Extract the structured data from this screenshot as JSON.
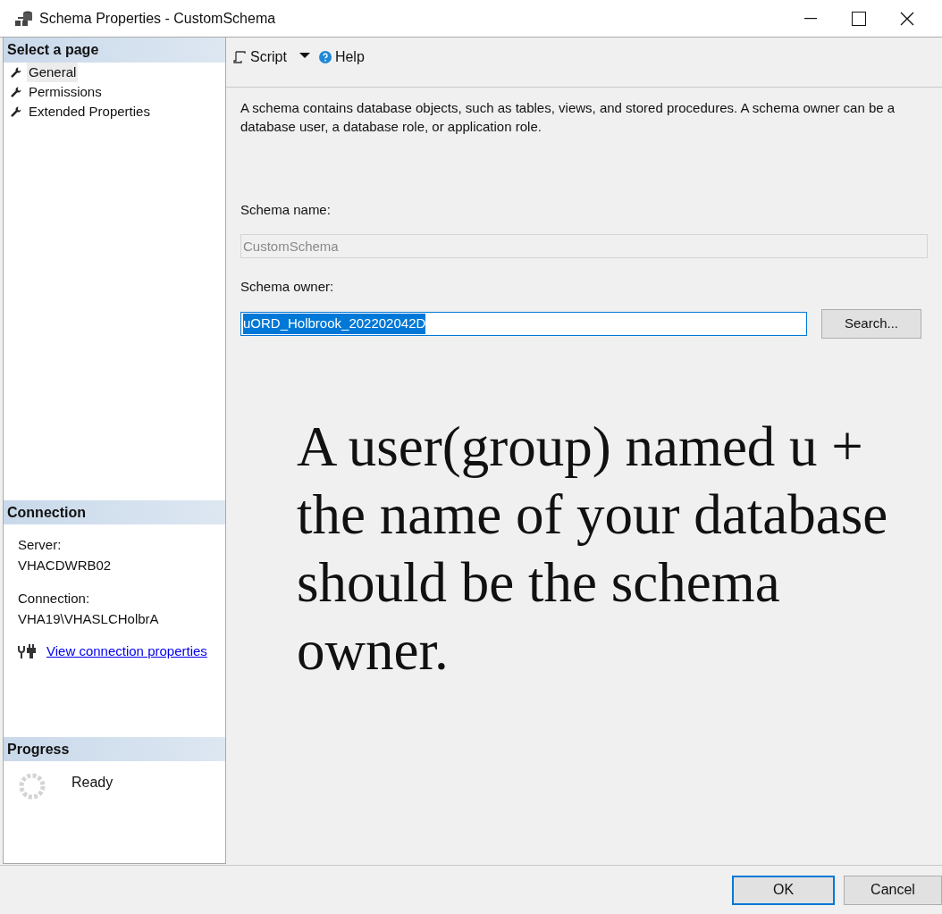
{
  "window": {
    "title": "Schema Properties - CustomSchema"
  },
  "sidebar": {
    "heading": "Select a page",
    "items": [
      {
        "label": "General",
        "selected": true
      },
      {
        "label": "Permissions",
        "selected": false
      },
      {
        "label": "Extended Properties",
        "selected": false
      }
    ]
  },
  "connection": {
    "heading": "Connection",
    "server_label": "Server:",
    "server": "VHACDWRB02",
    "connection_label": "Connection:",
    "connection": "VHA19\\VHASLCHolbrA",
    "link": "View connection properties"
  },
  "progress": {
    "heading": "Progress",
    "status": "Ready"
  },
  "toolbar": {
    "script": "Script",
    "help": "Help"
  },
  "description": "A schema contains database objects, such as tables, views, and stored procedures. A schema owner can be a database user, a database role, or application role.",
  "schema_name": {
    "label": "Schema name:",
    "value": "CustomSchema",
    "disabled": true
  },
  "schema_owner": {
    "label": "Schema owner:",
    "value": "uORD_Holbrook_202202042D",
    "selected": true
  },
  "search_button": "Search...",
  "annotation": "A user(group) named u + the name of your database should be the schema owner.",
  "buttons": {
    "ok": "OK",
    "cancel": "Cancel"
  }
}
